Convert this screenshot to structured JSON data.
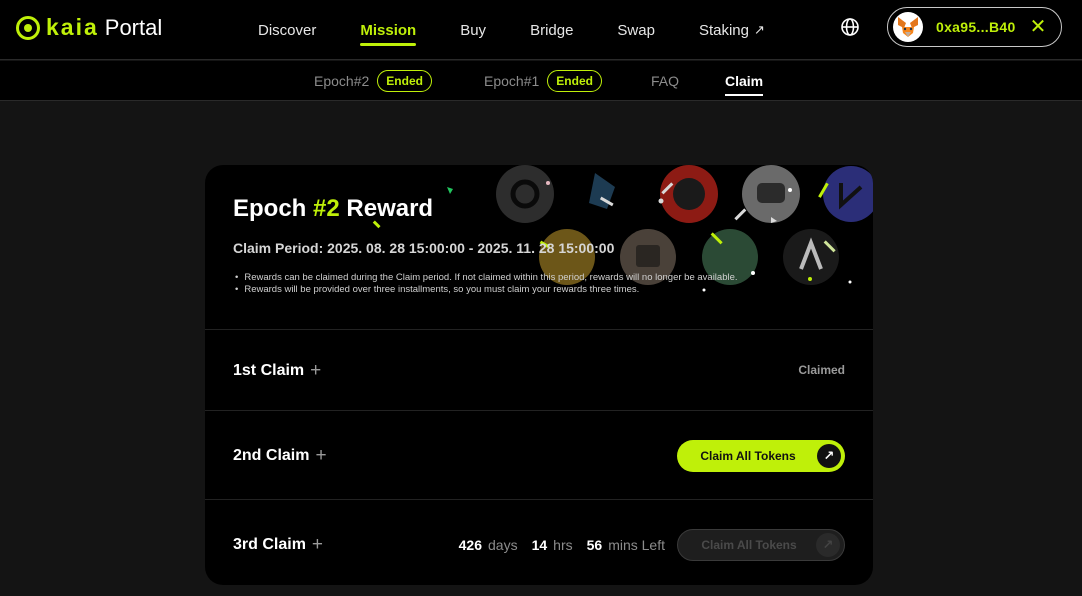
{
  "header": {
    "logo_text": "kaia",
    "logo_suffix": "Portal",
    "nav": [
      {
        "label": "Discover"
      },
      {
        "label": "Mission"
      },
      {
        "label": "Buy"
      },
      {
        "label": "Bridge"
      },
      {
        "label": "Swap"
      },
      {
        "label": "Staking"
      }
    ],
    "active_nav": "Mission",
    "wallet_address": "0xa95...B40"
  },
  "subnav": {
    "items": [
      {
        "label": "Epoch#2",
        "badge": "Ended"
      },
      {
        "label": "Epoch#1",
        "badge": "Ended"
      },
      {
        "label": "FAQ"
      },
      {
        "label": "Claim"
      }
    ],
    "active": "Claim"
  },
  "reward": {
    "title_prefix": "Epoch",
    "title_highlight": "#2",
    "title_suffix": "Reward",
    "claim_period": "Claim Period: 2025. 08. 28 15:00:00 - 2025. 11. 28 15:00:00",
    "notes": [
      "Rewards can be claimed during the Claim period. If not claimed within this period, rewards will no longer be available.",
      "Rewards will be provided over three installments, so you must claim your rewards three times."
    ]
  },
  "claims": [
    {
      "label": "1st Claim",
      "status": "Claimed"
    },
    {
      "label": "2nd Claim",
      "button": "Claim All Tokens"
    },
    {
      "label": "3rd Claim",
      "button": "Claim All Tokens",
      "countdown": {
        "days": "426",
        "days_unit": "days",
        "hrs": "14",
        "hrs_unit": "hrs",
        "mins": "56",
        "mins_unit": "mins Left"
      }
    }
  ],
  "colors": {
    "accent": "#bff009",
    "background": "#141414",
    "card": "#000000"
  }
}
